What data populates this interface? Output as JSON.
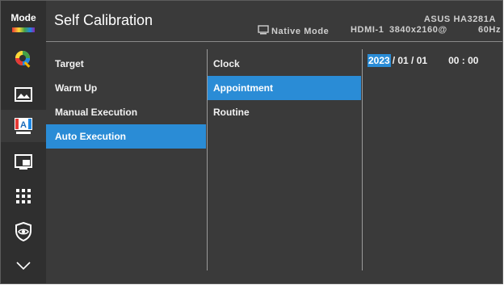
{
  "rail": {
    "mode_label": "Mode",
    "icons": [
      "color-icon",
      "image-icon",
      "self-calibration-icon",
      "pip-icon",
      "shortcut-icon",
      "eye-care-icon",
      "chevron-down-icon"
    ]
  },
  "header": {
    "title": "Self Calibration",
    "display_mode": "Native Mode",
    "input": "HDMI-1",
    "resolution": "3840x2160@",
    "refresh": "60Hz",
    "model": "ASUS HA3281A"
  },
  "menu_level1": {
    "items": [
      {
        "label": "Target"
      },
      {
        "label": "Warm Up"
      },
      {
        "label": "Manual Execution"
      },
      {
        "label": "Auto Execution",
        "selected": true
      }
    ]
  },
  "menu_level2": {
    "items": [
      {
        "label": "Clock"
      },
      {
        "label": "Appointment",
        "selected": true
      },
      {
        "label": "Routine"
      }
    ]
  },
  "appointment": {
    "year": "2023",
    "month_day": "/ 01 / 01",
    "time": "00 : 00"
  },
  "colors": {
    "accent": "#2a8cd6",
    "background": "#3a3a3a",
    "rail": "#2f2f2f"
  }
}
